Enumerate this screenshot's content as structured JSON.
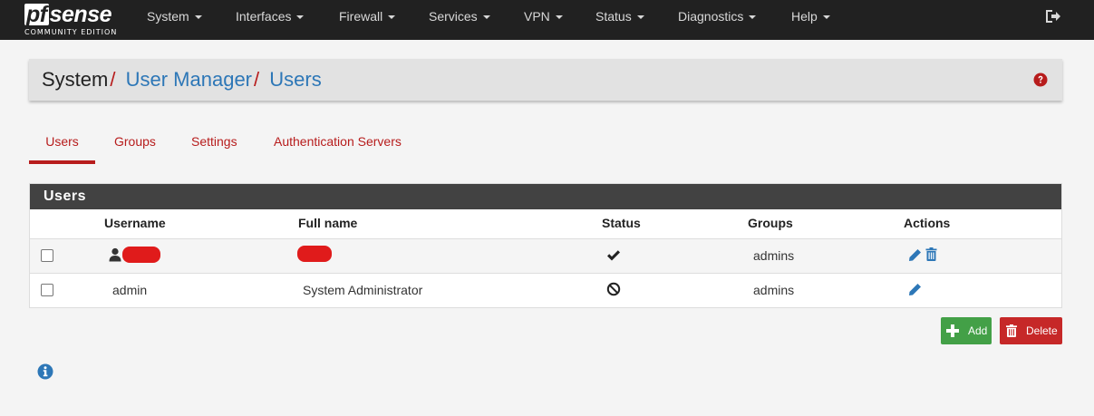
{
  "brand": {
    "logo_pf": "pf",
    "logo_rest": "sense",
    "edition": "COMMUNITY EDITION"
  },
  "nav": [
    {
      "label": "System"
    },
    {
      "label": "Interfaces"
    },
    {
      "label": "Firewall"
    },
    {
      "label": "Services"
    },
    {
      "label": "VPN"
    },
    {
      "label": "Status"
    },
    {
      "label": "Diagnostics"
    },
    {
      "label": "Help"
    }
  ],
  "breadcrumb": {
    "part1": "System",
    "sep": "/",
    "part2": "User Manager",
    "part3": "Users"
  },
  "tabs": [
    {
      "label": "Users",
      "active": true
    },
    {
      "label": "Groups"
    },
    {
      "label": "Settings"
    },
    {
      "label": "Authentication Servers"
    }
  ],
  "panel": {
    "title": "Users",
    "columns": [
      "Username",
      "Full name",
      "Status",
      "Groups",
      "Actions"
    ],
    "rows": [
      {
        "username": "",
        "fullname": "",
        "status": "check-icon",
        "groups": "admins",
        "actions": [
          "edit-icon",
          "trash-icon"
        ],
        "username_redacted": true,
        "fullname_redacted": true
      },
      {
        "username": "admin",
        "fullname": "System Administrator",
        "status": "ban-icon",
        "groups": "admins",
        "actions": [
          "edit-icon"
        ]
      }
    ]
  },
  "buttons": {
    "add": "Add",
    "delete": "Delete"
  },
  "colors": {
    "navbar": "#212121",
    "accent_red": "#b71c1c",
    "link_blue": "#2d77b7",
    "add_green": "#43a047",
    "delete_red": "#c62828"
  }
}
